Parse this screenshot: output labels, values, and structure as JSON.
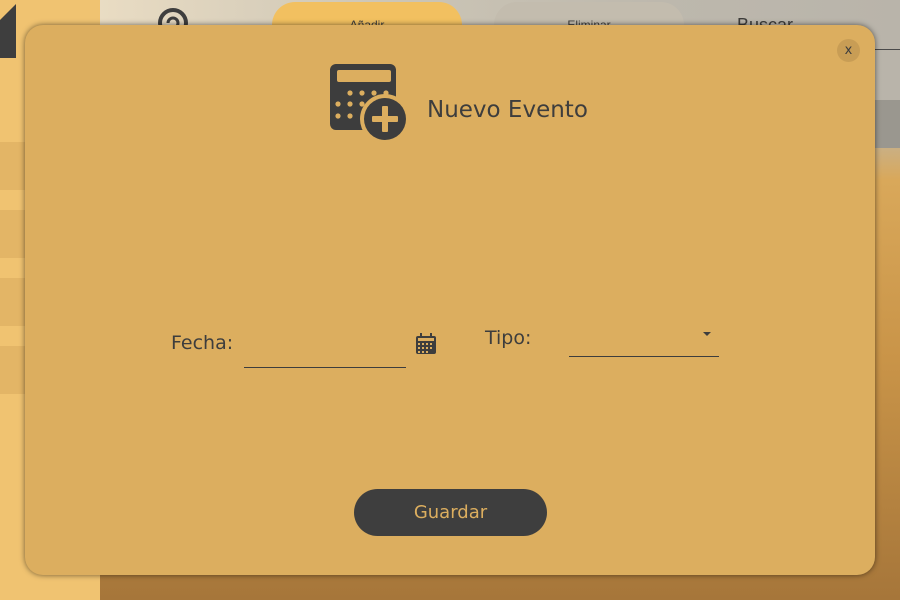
{
  "background_app": {
    "topbar": {
      "add_button_label": "Añadir",
      "delete_button_label": "Eliminar",
      "search_placeholder": "Buscar"
    },
    "logo_icon": "refresh-logo-icon",
    "home_icon": "home-icon"
  },
  "dialog": {
    "title": "Nuevo Evento",
    "header_icon": "calendar-add-icon",
    "close_label": "x",
    "fields": {
      "fecha": {
        "label": "Fecha:",
        "value": "",
        "icon": "calendar-icon"
      },
      "tipo": {
        "label": "Tipo:",
        "selected": "",
        "icon": "chevron-down-icon"
      }
    },
    "save_label": "Guardar"
  },
  "colors": {
    "dialog_background": "#dcae5f",
    "dark": "#3d3d3d",
    "sidebar": "#f0c371",
    "add_button": "#f2c060",
    "delete_button": "#c3bcae"
  }
}
